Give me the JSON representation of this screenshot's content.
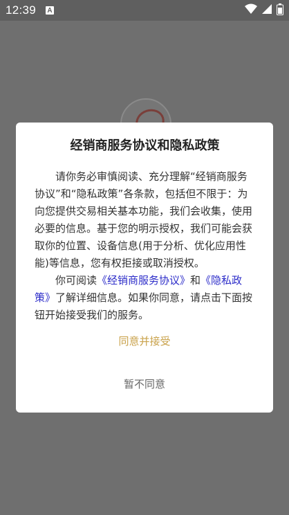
{
  "status_bar": {
    "time": "12:39",
    "notification_letter": "A",
    "icons": [
      "wifi-icon",
      "signal-icon",
      "battery-icon"
    ]
  },
  "dialog": {
    "title": "经销商服务协议和隐私政策",
    "paragraph1": "请你务必审慎阅读、充分理解“经销商服务协议”和“隐私政策”各条款，包括但不限于：为向您提供交易相关基本功能，我们会收集，使用必要的信息。基于您的明示授权，我们可能会获取你的位置、设备信息(用于分析、优化应用性能)等信息，您有权拒接或取消授权。",
    "paragraph2": {
      "prefix": "你可阅读",
      "link_agreement": "《经销商服务协议》",
      "and": "和",
      "link_privacy": "《隐私政策》",
      "suffix": "了解详细信息。如果你同意，请点击下面按钮开始接受我们的服务。"
    },
    "agree_label": "同意并接受",
    "disagree_label": "暂不同意"
  },
  "colors": {
    "overlay": "#6f6f6f",
    "link": "#2c2cc9",
    "agree": "#c9a24b",
    "disagree": "#666666"
  }
}
